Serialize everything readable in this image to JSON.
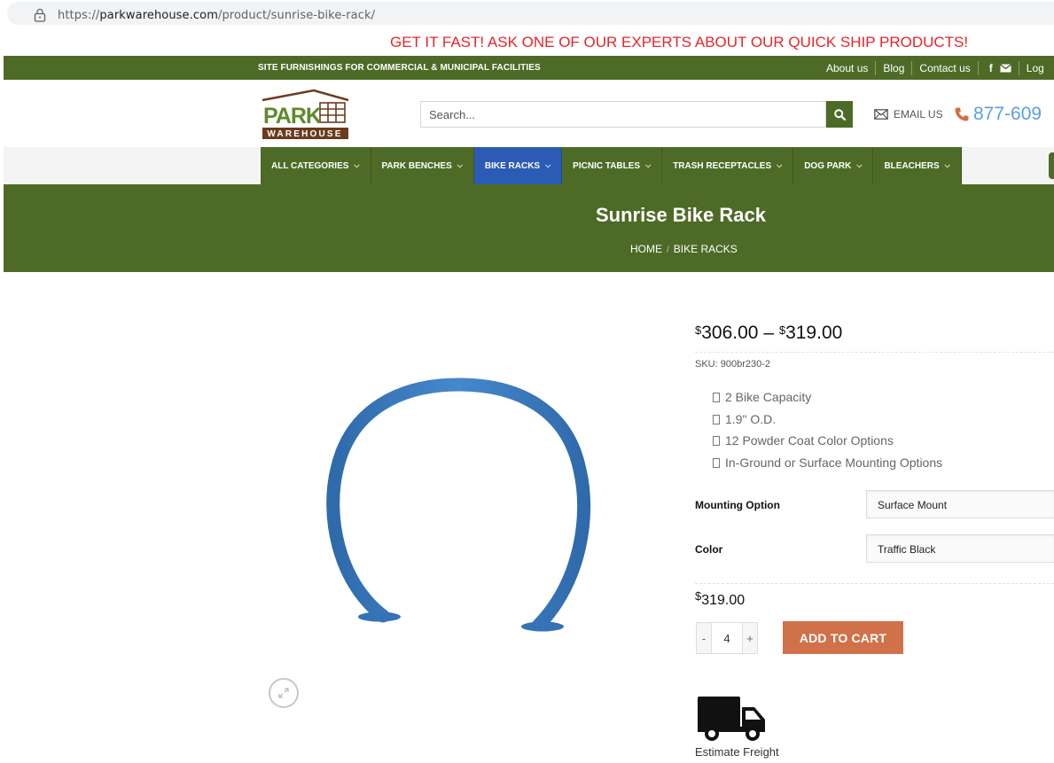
{
  "browser": {
    "url_prefix": "https://",
    "url_domain": "parkwarehouse.com",
    "url_path": "/product/sunrise-bike-rack/"
  },
  "promo": {
    "text": "GET IT FAST! ASK ONE OF OUR EXPERTS ABOUT OUR QUICK SHIP PRODUCTS!"
  },
  "topbar": {
    "tagline": "SITE FURNISHINGS FOR COMMERCIAL & MUNICIPAL FACILITIES",
    "links": [
      "About us",
      "Blog",
      "Contact us"
    ],
    "login_partial": "Log",
    "facebook_glyph": "f"
  },
  "header": {
    "logo_top": "PARK",
    "logo_bottom": "WAREHOUSE",
    "search_placeholder": "Search...",
    "email_label": "EMAIL US",
    "phone": "877-609"
  },
  "nav": {
    "items": [
      {
        "label": "ALL CATEGORIES",
        "active": false
      },
      {
        "label": "PARK BENCHES",
        "active": false
      },
      {
        "label": "BIKE RACKS",
        "active": true
      },
      {
        "label": "PICNIC TABLES",
        "active": false
      },
      {
        "label": "TRASH RECEPTACLES",
        "active": false
      },
      {
        "label": "DOG PARK",
        "active": false
      },
      {
        "label": "BLEACHERS",
        "active": false
      }
    ]
  },
  "page": {
    "title": "Sunrise Bike Rack",
    "breadcrumb": [
      "HOME",
      "BIKE RACKS"
    ],
    "breadcrumb_divider": "/"
  },
  "product": {
    "currency": "$",
    "price_min": "306.00",
    "price_sep": "–",
    "price_max": "319.00",
    "sku": "SKU: 900br230-2",
    "features": [
      "2 Bike Capacity",
      "1.9\" O.D.",
      "12 Powder Coat Color Options",
      "In-Ground or Surface Mounting Options"
    ],
    "options": [
      {
        "label": "Mounting Option",
        "value": "Surface Mount"
      },
      {
        "label": "Color",
        "value": "Traffic Black"
      }
    ],
    "selected_price": "319.00",
    "qty_minus": "-",
    "quantity": "4",
    "qty_plus": "+",
    "add_to_cart": "ADD TO CART",
    "freight_label": "Estimate Freight",
    "rack_color": "#3a7cc2"
  },
  "colors": {
    "brand_green": "#4d6b26",
    "active_blue": "#2b5bb5",
    "promo_red": "#e8242a",
    "cta_orange": "#d0714a",
    "phone_blue": "#5aa0e0"
  }
}
